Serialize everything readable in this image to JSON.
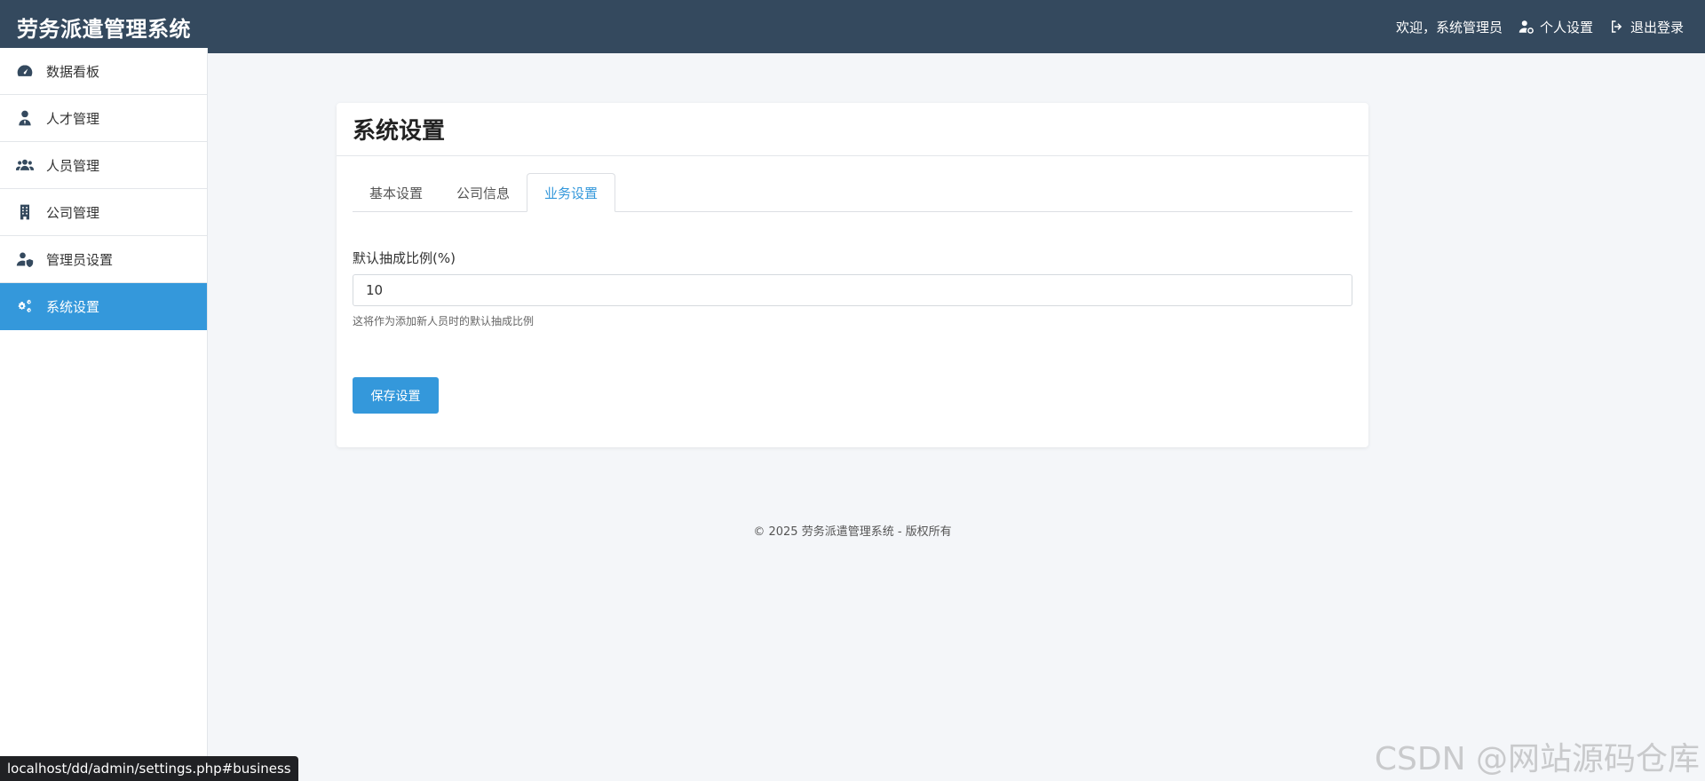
{
  "header": {
    "brand": "劳务派遣管理系统",
    "welcome": "欢迎，系统管理员",
    "profile_label": "个人设置",
    "logout_label": "退出登录"
  },
  "sidebar": {
    "items": [
      {
        "label": "数据看板",
        "icon": "dashboard-icon"
      },
      {
        "label": "人才管理",
        "icon": "user-tie-icon"
      },
      {
        "label": "人员管理",
        "icon": "users-icon"
      },
      {
        "label": "公司管理",
        "icon": "building-icon"
      },
      {
        "label": "管理员设置",
        "icon": "user-shield-icon"
      },
      {
        "label": "系统设置",
        "icon": "cogs-icon",
        "active": true
      }
    ]
  },
  "main": {
    "title": "系统设置",
    "tabs": [
      {
        "label": "基本设置"
      },
      {
        "label": "公司信息"
      },
      {
        "label": "业务设置",
        "active": true
      }
    ],
    "form": {
      "label": "默认抽成比例(%)",
      "value": "10",
      "help": "这将作为添加新人员时的默认抽成比例"
    },
    "save_label": "保存设置"
  },
  "footer": "© 2025 劳务派遣管理系统 - 版权所有",
  "status_url": "localhost/dd/admin/settings.php#business",
  "watermark": "CSDN @网站源码仓库",
  "colors": {
    "topbar": "#34495e",
    "accent": "#3498db",
    "background": "#f4f6f9"
  }
}
